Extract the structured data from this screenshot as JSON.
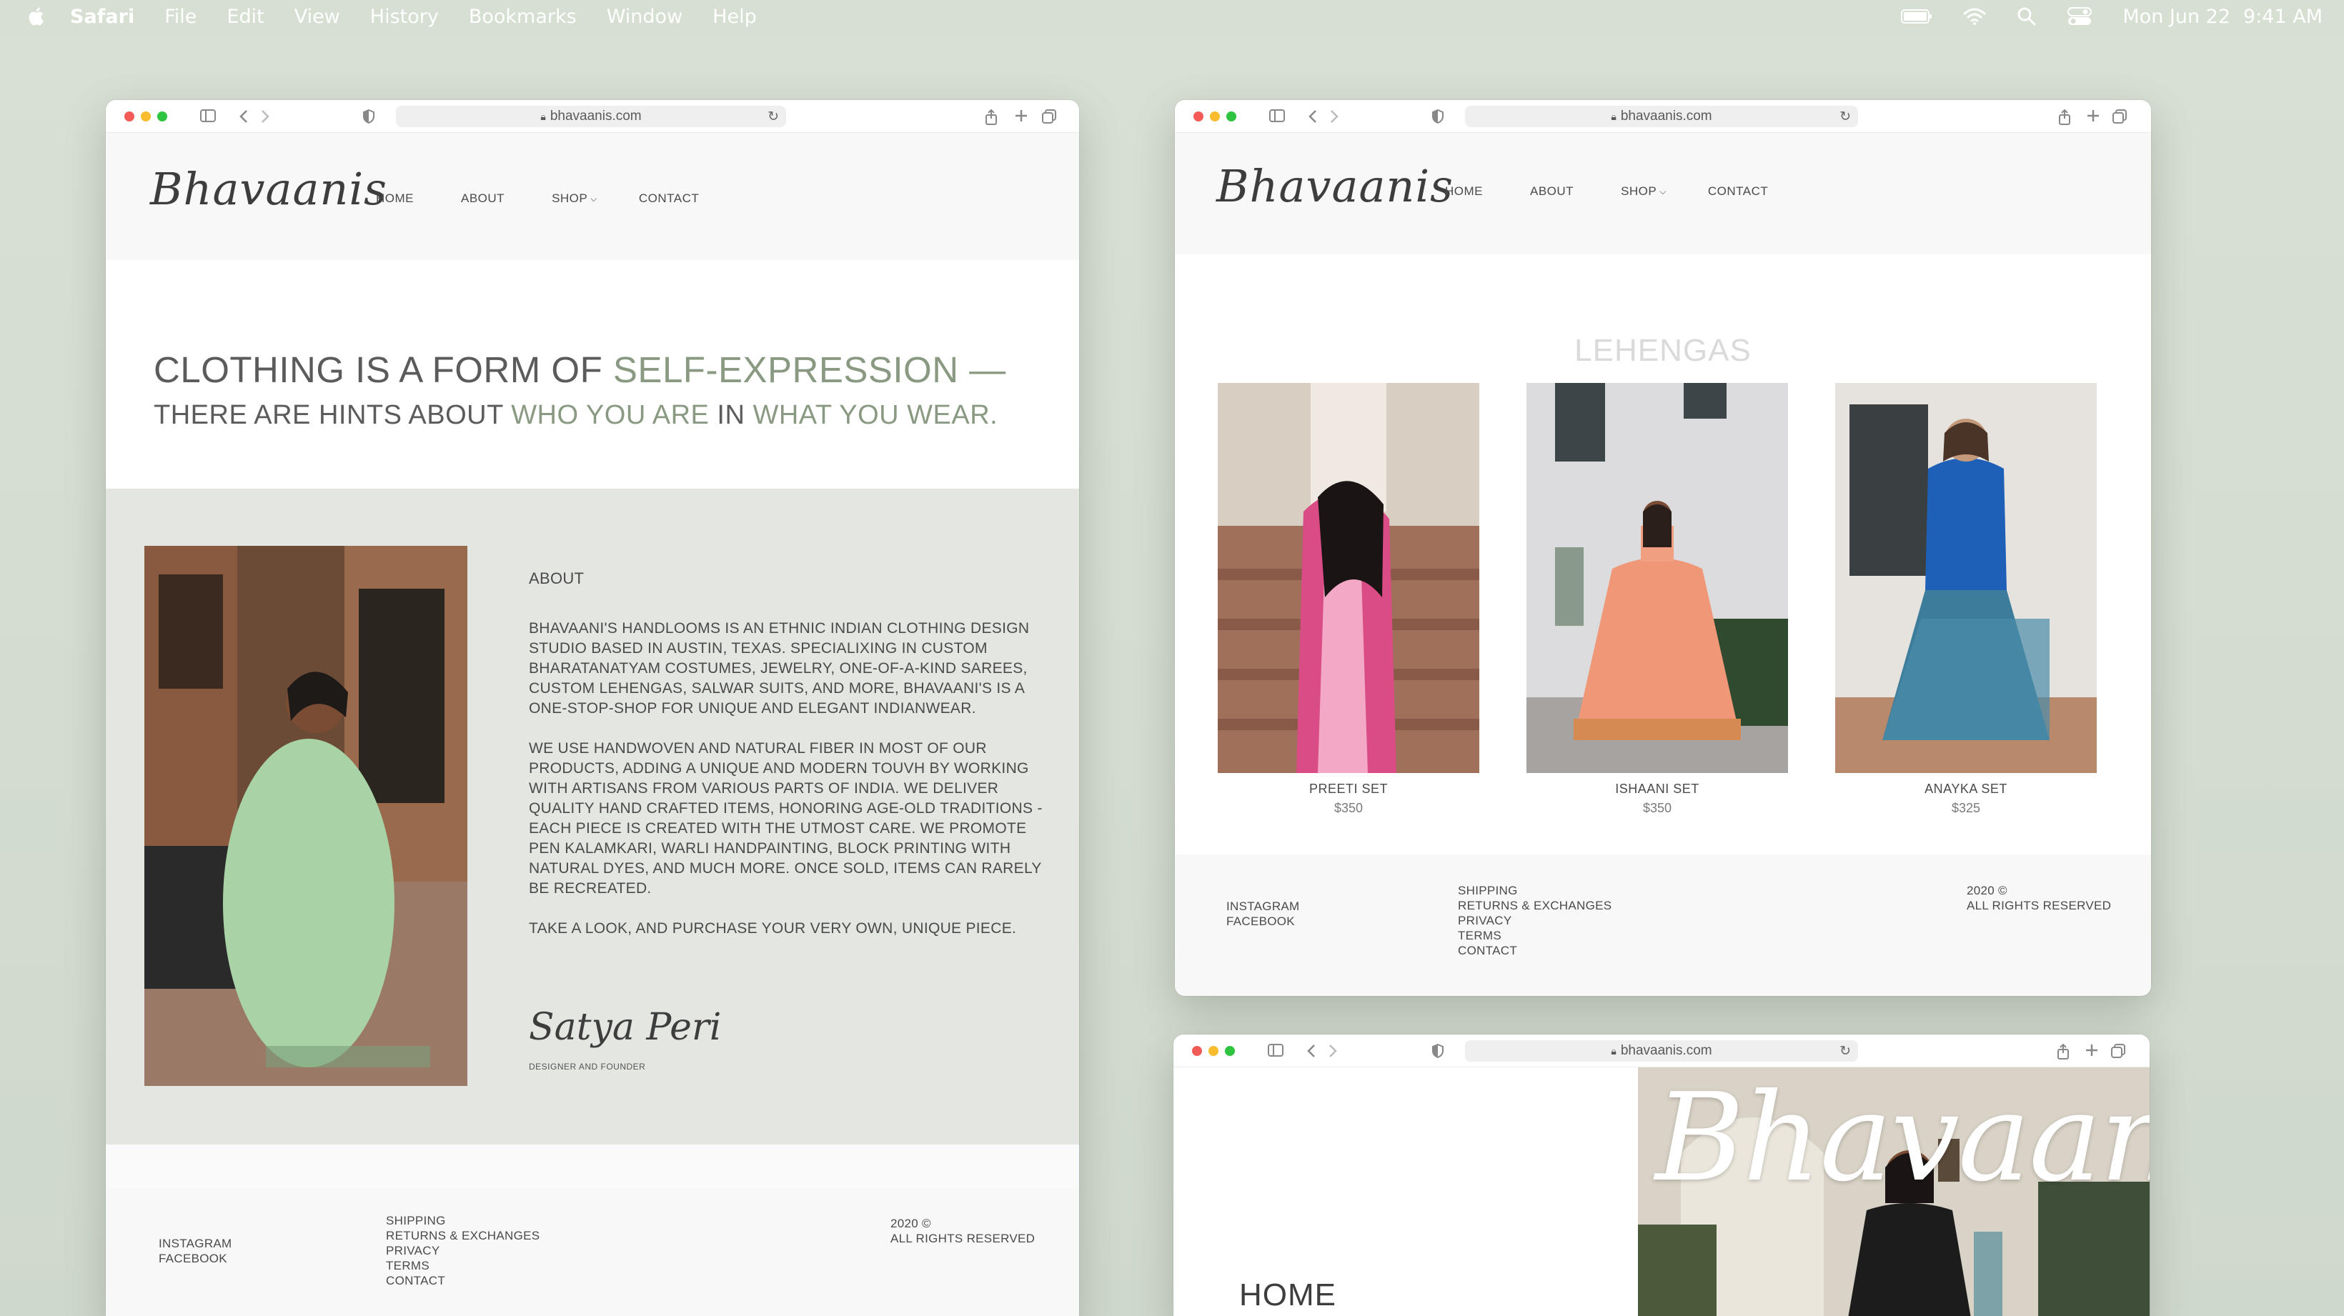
{
  "menubar": {
    "app": "Safari",
    "items": [
      "File",
      "Edit",
      "View",
      "History",
      "Bookmarks",
      "Window",
      "Help"
    ],
    "date": "Mon Jun 22",
    "time": "9:41 AM",
    "icons": [
      "apple-icon",
      "battery-icon",
      "wifi-icon",
      "spotlight-search-icon",
      "control-center-icon"
    ]
  },
  "browser": {
    "url": "bhavaanis.com"
  },
  "site": {
    "logo": "Bhavaanis",
    "nav": {
      "home": "HOME",
      "about": "ABOUT",
      "shop": "SHOP",
      "contact": "CONTACT"
    }
  },
  "home": {
    "hero_line1_a": "CLOTHING IS A FORM OF ",
    "hero_line1_b": "SELF-EXPRESSION —",
    "hero_line2_a": "THERE ARE HINTS ABOUT ",
    "hero_line2_b": "WHO YOU ARE",
    "hero_line2_c": " IN ",
    "hero_line2_d": "WHAT YOU WEAR.",
    "about_title": "ABOUT",
    "about_p1": "BHAVAANI'S HANDLOOMS IS AN ETHNIC INDIAN CLOTHING DESIGN STUDIO BASED IN AUSTIN, TEXAS. SPECIALIXING IN CUSTOM BHARATANATYAM COSTUMES, JEWELRY, ONE-OF-A-KIND SAREES, CUSTOM LEHENGAS, SALWAR SUITS, AND MORE, BHAVAANI'S IS A ONE-STOP-SHOP FOR UNIQUE AND ELEGANT INDIANWEAR.",
    "about_p2": "WE USE HANDWOVEN AND NATURAL FIBER IN MOST OF OUR PRODUCTS, ADDING A UNIQUE AND MODERN TOUVH BY WORKING WITH ARTISANS FROM VARIOUS PARTS OF INDIA. WE DELIVER QUALITY HAND CRAFTED ITEMS, HONORING AGE-OLD TRADITIONS - EACH PIECE IS CREATED WITH THE UTMOST CARE. WE PROMOTE PEN KALAMKARI, WARLI HANDPAINTING, BLOCK PRINTING WITH NATURAL DYES, AND MUCH MORE. ONCE SOLD, ITEMS CAN RARELY BE RECREATED.",
    "about_p3": "TAKE A LOOK, AND PURCHASE YOUR VERY OWN, UNIQUE PIECE.",
    "signature": "Satya Peri",
    "signature_title": "DESIGNER AND FOUNDER"
  },
  "footer": {
    "social": [
      "INSTAGRAM",
      "FACEBOOK"
    ],
    "links": [
      "SHIPPING",
      "RETURNS & EXCHANGES",
      "PRIVACY",
      "TERMS",
      "CONTACT"
    ],
    "copyright_year": "2020 ©",
    "rights": "ALL RIGHTS RESERVED"
  },
  "shop": {
    "category": "LEHENGAS",
    "products": [
      {
        "name": "PREETI SET",
        "price": "$350"
      },
      {
        "name": "ISHAANI SET",
        "price": "$350"
      },
      {
        "name": "ANAYKA SET",
        "price": "$325"
      }
    ]
  },
  "landing": {
    "script_title": "Bhavaani's",
    "home_label": "HOME"
  },
  "colors": {
    "accent_green": "#8a9a82",
    "desktop_bg": "#d3dccf",
    "text_dark": "#4a4a4a"
  }
}
